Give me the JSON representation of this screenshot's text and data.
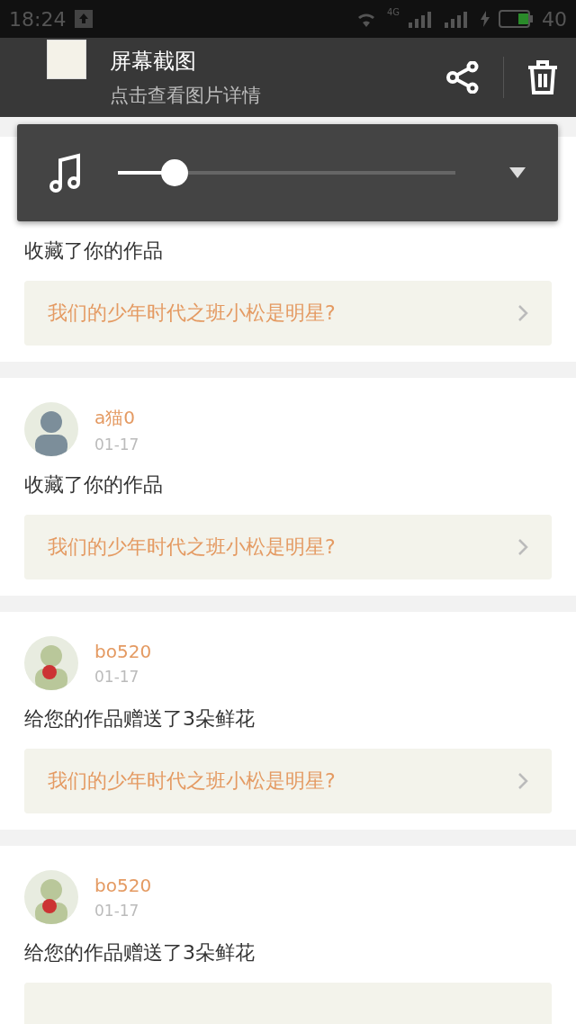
{
  "status_bar": {
    "time": "18:24",
    "network": "4G",
    "battery": "40"
  },
  "notification": {
    "title": "屏幕截图",
    "subtitle": "点击查看图片详情"
  },
  "volume_panel": {
    "level": 0.14
  },
  "messages": [
    {
      "action": "收藏了你的作品",
      "work": "我们的少年时代之班小松是明星?"
    },
    {
      "user": "a猫0",
      "date": "01-17",
      "action": "收藏了你的作品",
      "work": "我们的少年时代之班小松是明星?"
    },
    {
      "user": "bo520",
      "date": "01-17",
      "action": "给您的作品赠送了3朵鲜花",
      "work": "我们的少年时代之班小松是明星?"
    },
    {
      "user": "bo520",
      "date": "01-17",
      "action": "给您的作品赠送了3朵鲜花"
    }
  ]
}
